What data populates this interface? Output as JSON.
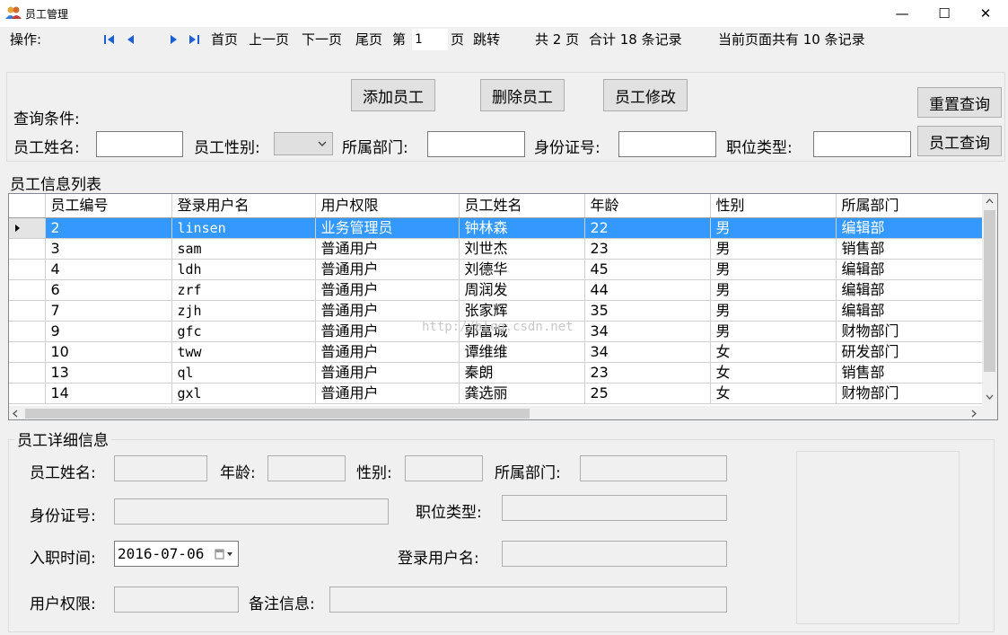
{
  "window": {
    "title": "员工管理",
    "controls": [
      "—",
      "☐",
      "✕"
    ]
  },
  "toolbar": {
    "label": "操作:",
    "first": "首页",
    "prev": "上一页",
    "next": "下一页",
    "last": "尾页",
    "page_prefix": "第",
    "page_value": "1",
    "page_suffix": "页",
    "jump": "跳转",
    "total_pages": "共 2 页",
    "total_records": "合计 18 条记录",
    "current_records": "当前页面共有 10 条记录"
  },
  "query": {
    "title": "查询条件:",
    "add_btn": "添加员工",
    "delete_btn": "删除员工",
    "edit_btn": "员工修改",
    "reset_btn": "重置查询",
    "search_btn": "员工查询",
    "name_label": "员工姓名:",
    "gender_label": "员工性别:",
    "dept_label": "所属部门:",
    "idcard_label": "身份证号:",
    "position_label": "职位类型:"
  },
  "list": {
    "title": "员工信息列表",
    "columns": [
      "员工编号",
      "登录用户名",
      "用户权限",
      "员工姓名",
      "年龄",
      "性别",
      "所属部门"
    ],
    "rows": [
      [
        "2",
        "linsen",
        "业务管理员",
        "钟林森",
        "22",
        "男",
        "编辑部"
      ],
      [
        "3",
        "sam",
        "普通用户",
        "刘世杰",
        "23",
        "男",
        "销售部"
      ],
      [
        "4",
        "ldh",
        "普通用户",
        "刘德华",
        "45",
        "男",
        "编辑部"
      ],
      [
        "6",
        "zrf",
        "普通用户",
        "周润发",
        "44",
        "男",
        "编辑部"
      ],
      [
        "7",
        "zjh",
        "普通用户",
        "张家辉",
        "35",
        "男",
        "编辑部"
      ],
      [
        "9",
        "gfc",
        "普通用户",
        "郭富城",
        "34",
        "男",
        "财物部门"
      ],
      [
        "10",
        "tww",
        "普通用户",
        "谭维维",
        "34",
        "女",
        "研发部门"
      ],
      [
        "13",
        "ql",
        "普通用户",
        "秦朗",
        "23",
        "女",
        "销售部"
      ],
      [
        "14",
        "gxl",
        "普通用户",
        "龚选丽",
        "25",
        "女",
        "财物部门"
      ]
    ],
    "watermark": "http://blog.csdn.net"
  },
  "detail": {
    "title": "员工详细信息",
    "name_label": "员工姓名:",
    "age_label": "年龄:",
    "gender_label": "性别:",
    "dept_label": "所属部门:",
    "idcard_label": "身份证号:",
    "position_label": "职位类型:",
    "hire_label": "入职时间:",
    "hire_value": "2016-07-06",
    "username_label": "登录用户名:",
    "perm_label": "用户权限:",
    "note_label": "备注信息:"
  },
  "colors": {
    "selection": "#3399ff",
    "window_bg": "#f0f0f0",
    "nav_icon": "#1a5fd6"
  }
}
